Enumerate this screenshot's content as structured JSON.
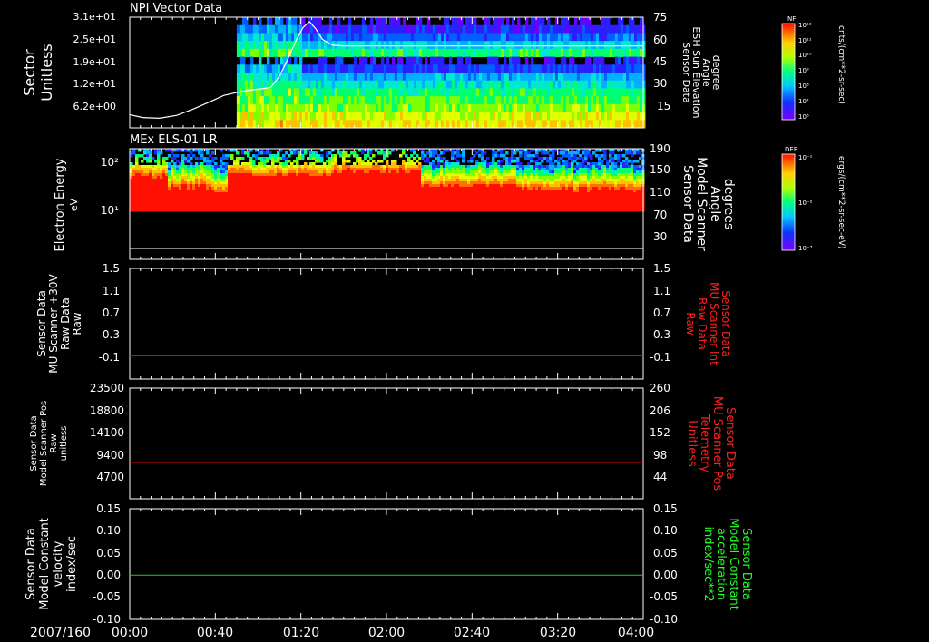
{
  "figure": {
    "date_label": "2007/160",
    "time_ticks": [
      "00:00",
      "00:40",
      "01:20",
      "02:00",
      "02:40",
      "03:20",
      "04:00"
    ],
    "time_range_minutes": [
      0,
      240
    ]
  },
  "chart_data": [
    {
      "panel": "npi",
      "type": "heatmap",
      "title": "NPI Vector Data",
      "ylabel_lines": [
        "Sector",
        "Unitless"
      ],
      "yticks_left": [
        "3.1e+01",
        "2.5e+01",
        "1.9e+01",
        "1.2e+01",
        "6.2e+00"
      ],
      "ylabel_right_lines": [
        "Sensor Data",
        "ESH Sun Elevation",
        "Angle",
        "degree"
      ],
      "yticks_right": [
        "75",
        "60",
        "45",
        "30",
        "15"
      ],
      "ylim_right": [
        0,
        75
      ],
      "data_start_minutes": 50,
      "line_series": {
        "name": "ESH Sun Elevation Angle",
        "x_minutes": [
          0,
          6,
          14,
          22,
          30,
          38,
          44,
          50,
          56,
          62,
          66,
          70,
          74,
          78,
          81,
          84,
          87,
          90,
          95,
          100,
          120,
          160,
          200,
          240
        ],
        "y_degrees": [
          9,
          7,
          6.5,
          8.5,
          13,
          18,
          22,
          24,
          25.5,
          26.5,
          27.5,
          35,
          47,
          60,
          68,
          72,
          67,
          60,
          56,
          55.5,
          55.5,
          55.5,
          55.5,
          55.5
        ]
      },
      "colorbar": {
        "label": "NF",
        "units": "cnts/(cm**2-sr-sec)",
        "tick_labels": [
          "10¹²",
          "10¹¹",
          "10¹⁰",
          "10⁹",
          "10⁸",
          "10⁷",
          "10⁶"
        ]
      }
    },
    {
      "panel": "els",
      "type": "heatmap",
      "title": "MEx ELS-01 LR",
      "ylabel_lines": [
        "Electron Energy",
        "eV"
      ],
      "yticks_left": [
        "10²",
        "10¹"
      ],
      "ylim_left_log": [
        0.3,
        200
      ],
      "ylabel_right_lines": [
        "Sensor Data",
        "Model Scanner",
        "Angle",
        "degrees"
      ],
      "yticks_right": [
        "190",
        "150",
        "110",
        "70",
        "30"
      ],
      "ylim_right": [
        0,
        190
      ],
      "lower_energy_cutoff_eV": 11,
      "line_series": {
        "name": "Model Scanner Angle",
        "value_degrees": 5
      },
      "colorbar": {
        "label": "DEF",
        "units": "ergs/(cm**2-sr-sec-eV)",
        "tick_labels": [
          "10⁻¹",
          "10⁻²",
          "10⁻³"
        ]
      }
    },
    {
      "panel": "mu_raw",
      "type": "line",
      "ylabel_lines": [
        "Sensor Data",
        "MU Scanner +30V",
        "Raw Data",
        "Raw"
      ],
      "yticks_left": [
        "1.5",
        "1.1",
        "0.7",
        "0.3",
        "-0.1"
      ],
      "ylim": [
        -0.4,
        1.5
      ],
      "ylabel_right_lines": [
        "Sensor Data",
        "MU Scanner Int",
        "Raw Data",
        "Raw"
      ],
      "yticks_right": [
        "1.5",
        "1.1",
        "0.7",
        "0.3",
        "-0.1"
      ],
      "series": [
        {
          "color": "#dd1111",
          "y_const": 0.0
        }
      ]
    },
    {
      "panel": "scanner_pos",
      "type": "line",
      "ylabel_lines": [
        "Sensor Data",
        "Model Scanner Pos",
        "Raw",
        "unitless"
      ],
      "yticks_left": [
        "23500",
        "18800",
        "14100",
        "9400",
        "4700"
      ],
      "ylim": [
        0,
        23500
      ],
      "ylabel_right_lines": [
        "Sensor Data",
        "MU Scanner Pos",
        "Telemetry",
        "Unitless"
      ],
      "yticks_right": [
        "260",
        "206",
        "152",
        "98",
        "44"
      ],
      "series": [
        {
          "color": "#dd1111",
          "y_const": 7700
        }
      ]
    },
    {
      "panel": "velocity",
      "type": "line",
      "ylabel_lines": [
        "Sensor Data",
        "Model Constant",
        "velocity",
        "index/sec"
      ],
      "yticks_left": [
        "0.15",
        "0.10",
        "0.05",
        "0.00",
        "-0.05",
        "-0.10"
      ],
      "ylim": [
        -0.1,
        0.15
      ],
      "ylabel_right_lines": [
        "Sensor Data",
        "Model Constant",
        "acceleration",
        "index/sec**2"
      ],
      "yticks_right": [
        "0.15",
        "0.10",
        "0.05",
        "0.00",
        "-0.05",
        "-0.10"
      ],
      "series": [
        {
          "color": "#22cc22",
          "y_const": 0.0
        }
      ]
    }
  ],
  "colors": {
    "right_label_mu": "#ff2020",
    "right_label_velocity": "#22ff22",
    "axis": "#ffffff",
    "background": "#000000"
  }
}
